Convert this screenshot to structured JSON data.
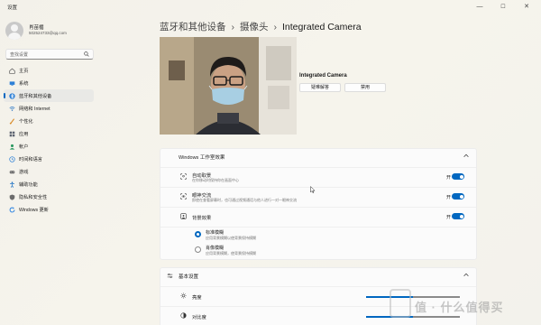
{
  "window": {
    "title": "设置",
    "controls": [
      "—",
      "☐",
      "✕"
    ]
  },
  "user": {
    "name": "肖苗楣",
    "email": "502524733@qq.com"
  },
  "search": {
    "placeholder": "查找设置"
  },
  "sidebar": {
    "items": [
      {
        "label": "主页",
        "icon": "home-icon",
        "color": "#555555"
      },
      {
        "label": "系统",
        "icon": "system-icon",
        "color": "#2b7fd6"
      },
      {
        "label": "蓝牙和其他设备",
        "icon": "bluetooth-icon",
        "color": "#2b7fd6",
        "selected": true
      },
      {
        "label": "网络和 Internet",
        "icon": "wifi-icon",
        "color": "#3b80c7"
      },
      {
        "label": "个性化",
        "icon": "personalization-icon",
        "color": "#d98b28"
      },
      {
        "label": "应用",
        "icon": "apps-icon",
        "color": "#5c6370"
      },
      {
        "label": "帐户",
        "icon": "accounts-icon",
        "color": "#2f9a63"
      },
      {
        "label": "时间和语言",
        "icon": "time-language-icon",
        "color": "#2b7fd6"
      },
      {
        "label": "游戏",
        "icon": "gaming-icon",
        "color": "#666666"
      },
      {
        "label": "辅助功能",
        "icon": "accessibility-icon",
        "color": "#1f72c4"
      },
      {
        "label": "隐私和安全性",
        "icon": "privacy-icon",
        "color": "#6b6b6b"
      },
      {
        "label": "Windows 更新",
        "icon": "windows-update-icon",
        "color": "#1e7be0"
      }
    ]
  },
  "breadcrumb": {
    "level1": "蓝牙和其他设备",
    "level2": "摄像头",
    "current": "Integrated Camera",
    "separator": "›"
  },
  "camera": {
    "name": "Integrated Camera",
    "troubleshoot": "疑难解答",
    "disable": "禁用"
  },
  "studio_effects": {
    "title": "Windows 工作室效果",
    "auto_framing": {
      "title": "自动取景",
      "desc": "在你移动时保持你在画面中心",
      "state": "开"
    },
    "eye_contact": {
      "title": "眼神交流",
      "desc": "即使在查看屏幕时，也可通过视频通话与他人进行一对一眼神交流",
      "state": "开"
    },
    "background": {
      "title": "背景效果",
      "state": "开"
    },
    "standard_blur": {
      "title": "标准模糊",
      "desc": "应用背景模糊以使背景保持模糊"
    },
    "portrait_blur": {
      "title": "肖像模糊",
      "desc": "应用背景模糊，使背景保持模糊"
    }
  },
  "basic": {
    "title": "基本设置",
    "brightness": {
      "label": "亮度",
      "value": 0.5
    },
    "contrast": {
      "label": "对比度",
      "value": 0.5
    }
  },
  "watermark": {
    "text": "值 · 什么值得买"
  }
}
